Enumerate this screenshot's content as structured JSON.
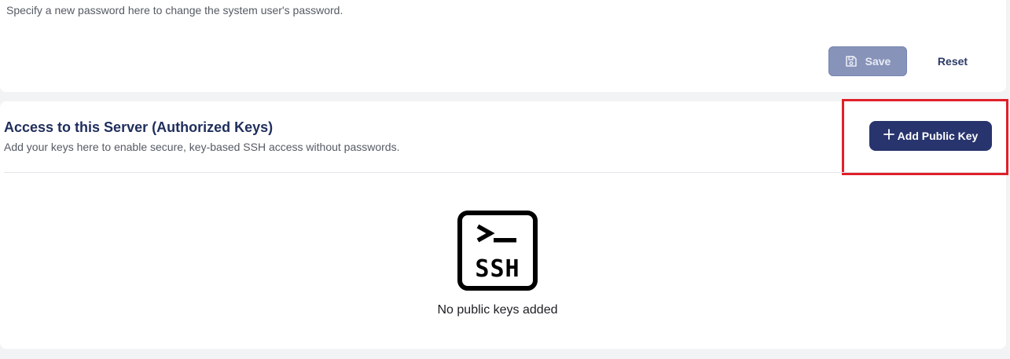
{
  "password_section": {
    "description": "Specify a new password here to change the system user's password.",
    "save_label": "Save",
    "reset_label": "Reset",
    "save_icon": "save-icon"
  },
  "keys_section": {
    "title": "Access to this Server (Authorized Keys)",
    "description": "Add your keys here to enable secure, key-based SSH access without passwords.",
    "add_button_label": "Add Public Key",
    "add_icon": "plus-icon",
    "empty_icon": "ssh-terminal-icon",
    "empty_message": "No public keys added"
  },
  "colors": {
    "primary": "#27346d",
    "save_disabled": "#8793b9",
    "highlight": "#e0202a",
    "title": "#1f2e5c"
  }
}
